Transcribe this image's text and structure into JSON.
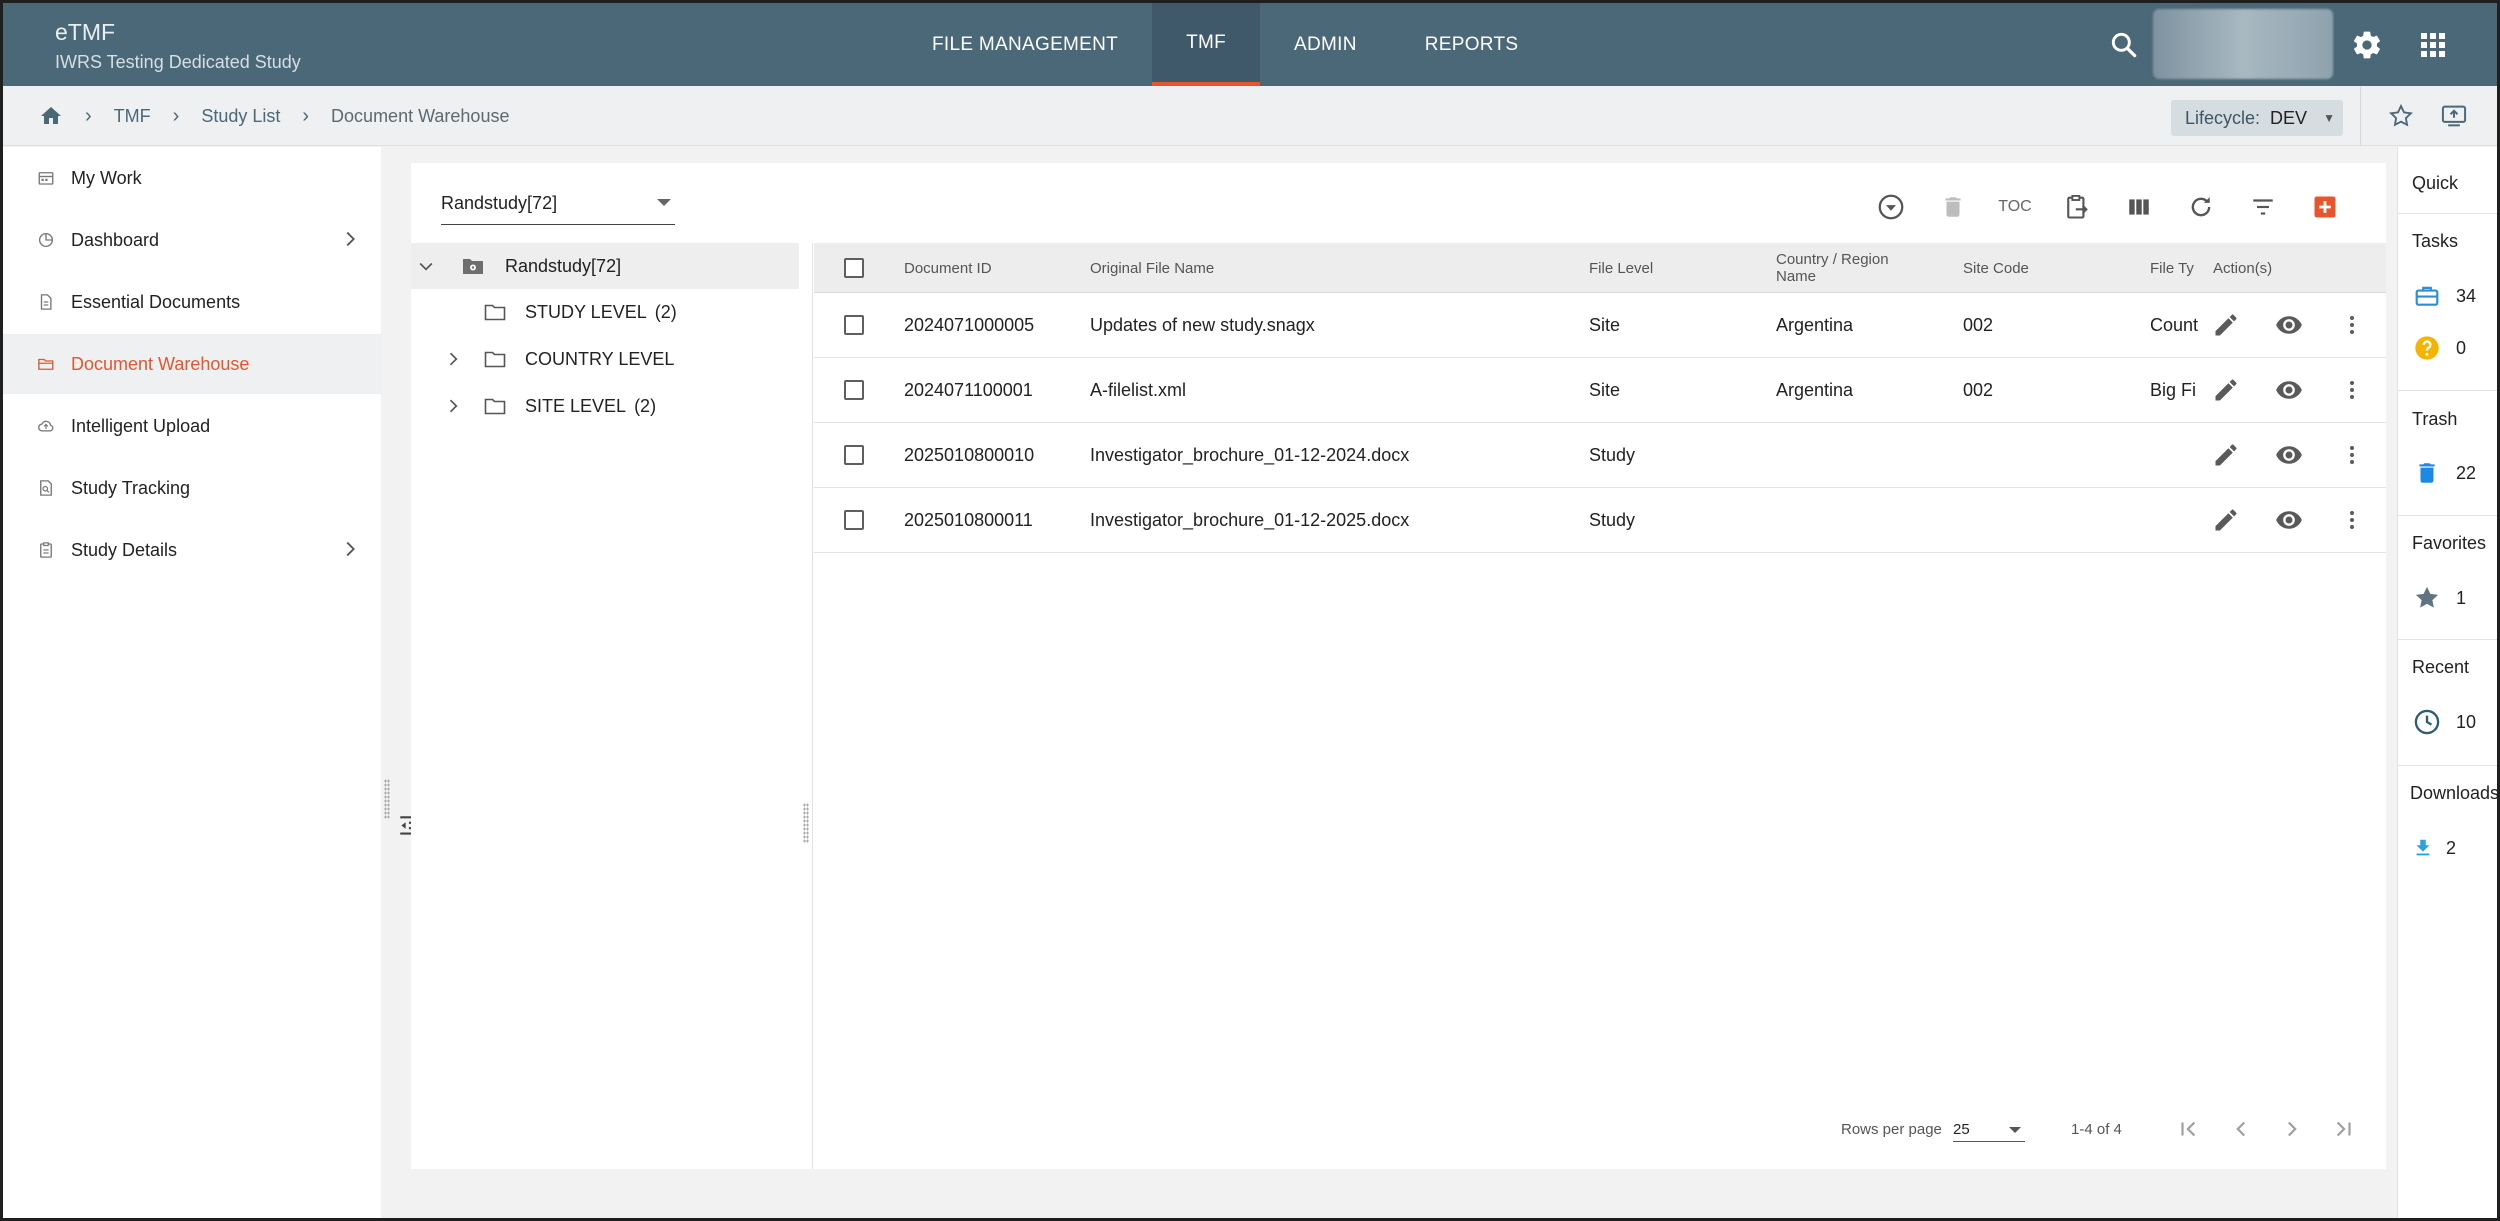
{
  "app": {
    "title": "eTMF",
    "subtitle": "IWRS Testing Dedicated Study"
  },
  "nav": [
    {
      "label": "FILE MANAGEMENT"
    },
    {
      "label": "TMF"
    },
    {
      "label": "ADMIN"
    },
    {
      "label": "REPORTS"
    }
  ],
  "breadcrumb": {
    "tmf": "TMF",
    "study_list": "Study List",
    "current": "Document Warehouse"
  },
  "lifecycle": {
    "label": "Lifecycle:",
    "value": "DEV"
  },
  "sidebar": {
    "items": [
      {
        "label": "My Work",
        "icon": "calendar-icon"
      },
      {
        "label": "Dashboard",
        "icon": "chart-pie-icon"
      },
      {
        "label": "Essential Documents",
        "icon": "document-icon"
      },
      {
        "label": "Document Warehouse",
        "icon": "folder-open-icon"
      },
      {
        "label": "Intelligent Upload",
        "icon": "cloud-upload-icon"
      },
      {
        "label": "Study Tracking",
        "icon": "tracking-icon"
      },
      {
        "label": "Study Details",
        "icon": "clipboard-icon"
      }
    ]
  },
  "study_select": {
    "value": "Randstudy[72]"
  },
  "toolbar": {
    "toc_label": "TOC"
  },
  "tree": {
    "root": "Randstudy[72]",
    "nodes": [
      {
        "label": "STUDY LEVEL",
        "count": "(2)"
      },
      {
        "label": "COUNTRY LEVEL",
        "count": ""
      },
      {
        "label": "SITE LEVEL",
        "count": "(2)"
      }
    ]
  },
  "table": {
    "headers": {
      "doc_id": "Document ID",
      "file_name": "Original File Name",
      "file_level": "File Level",
      "country_line1": "Country / Region",
      "country_line2": "Name",
      "site_code": "Site Code",
      "file_type": "File Ty",
      "actions": "Action(s)"
    },
    "rows": [
      {
        "doc_id": "2024071000005",
        "file_name": "Updates of new study.snagx",
        "file_level": "Site",
        "country": "Argentina",
        "site_code": "002",
        "file_type": "Count"
      },
      {
        "doc_id": "2024071100001",
        "file_name": "A-filelist.xml",
        "file_level": "Site",
        "country": "Argentina",
        "site_code": "002",
        "file_type": "Big Fi"
      },
      {
        "doc_id": "2025010800010",
        "file_name": "Investigator_brochure_01-12-2024.docx",
        "file_level": "Study",
        "country": "",
        "site_code": "",
        "file_type": ""
      },
      {
        "doc_id": "2025010800011",
        "file_name": "Investigator_brochure_01-12-2025.docx",
        "file_level": "Study",
        "country": "",
        "site_code": "",
        "file_type": ""
      }
    ]
  },
  "pagination": {
    "rows_per_page_label": "Rows per page",
    "rows_per_page": "25",
    "range": "1-4 of 4"
  },
  "quick": {
    "title": "Quick",
    "tasks_title": "Tasks",
    "tasks_count": "34",
    "questions_count": "0",
    "trash_title": "Trash",
    "trash_count": "22",
    "favorites_title": "Favorites",
    "favorites_count": "1",
    "recent_title": "Recent",
    "recent_count": "10",
    "downloads_title": "Downloads",
    "downloads_count": "2"
  },
  "colors": {
    "header": "#4b6878",
    "accent": "#e8542b",
    "task_blue": "#2a8fd6",
    "question_yellow": "#f4b400",
    "trash_blue": "#1e88e5"
  }
}
